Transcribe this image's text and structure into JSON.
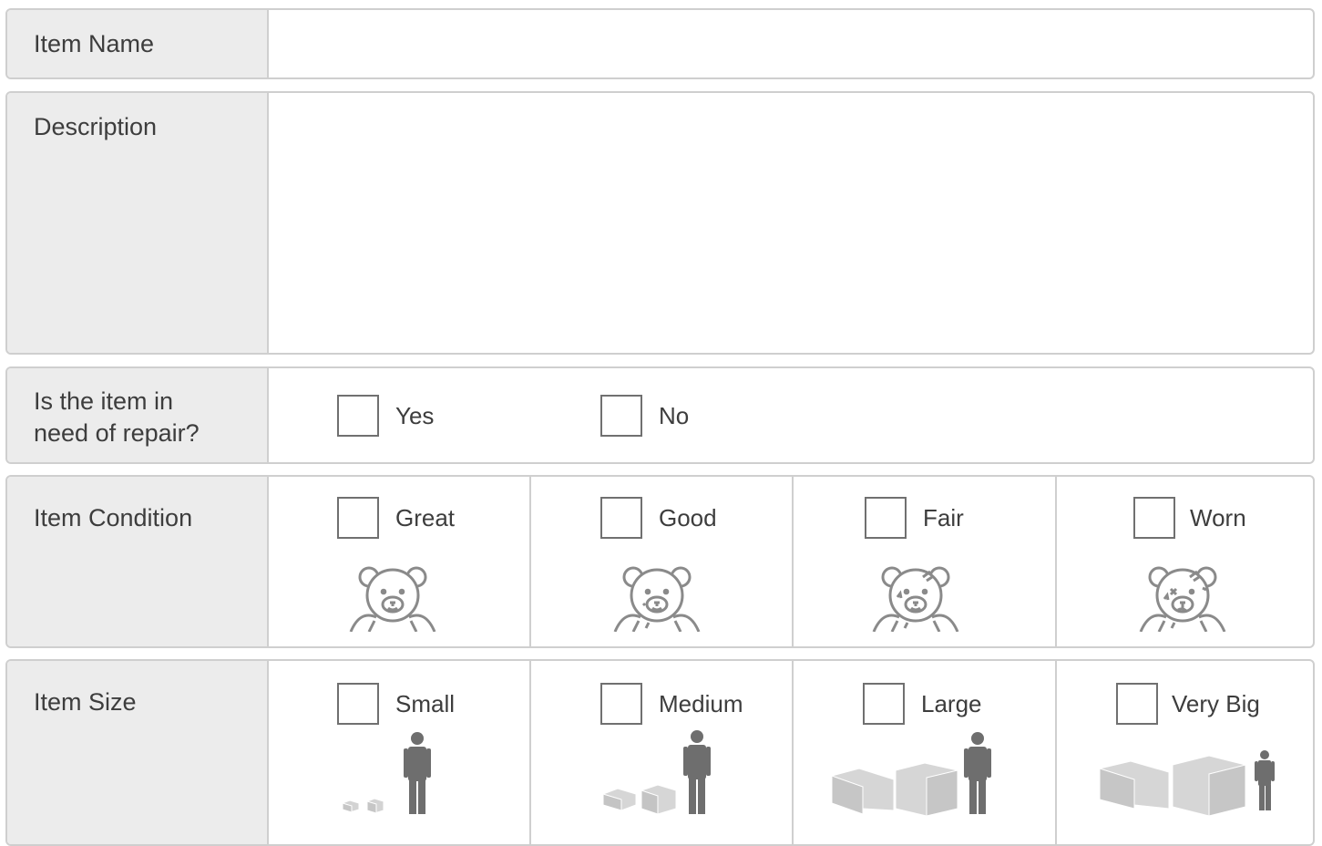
{
  "form": {
    "item_name": {
      "label": "Item Name",
      "value": ""
    },
    "description": {
      "label": "Description",
      "value": ""
    },
    "repair": {
      "label_line1": "Is the item in",
      "label_line2": "need of repair?",
      "options": [
        "Yes",
        "No"
      ]
    },
    "condition": {
      "label": "Item Condition",
      "options": [
        "Great",
        "Good",
        "Fair",
        "Worn"
      ],
      "icons": [
        "teddy-bear-great-icon",
        "teddy-bear-good-icon",
        "teddy-bear-fair-icon",
        "teddy-bear-worn-icon"
      ]
    },
    "size": {
      "label": "Item Size",
      "options": [
        "Small",
        "Medium",
        "Large",
        "Very Big"
      ],
      "icons": [
        "small-boxes-person-icon",
        "medium-boxes-person-icon",
        "large-boxes-person-icon",
        "very-big-boxes-person-icon"
      ]
    }
  },
  "colors": {
    "label_bg": "#ececec",
    "border": "#cfcfcf",
    "icon_gray": "#6e6e6e",
    "box_light": "#d9d9d9"
  }
}
